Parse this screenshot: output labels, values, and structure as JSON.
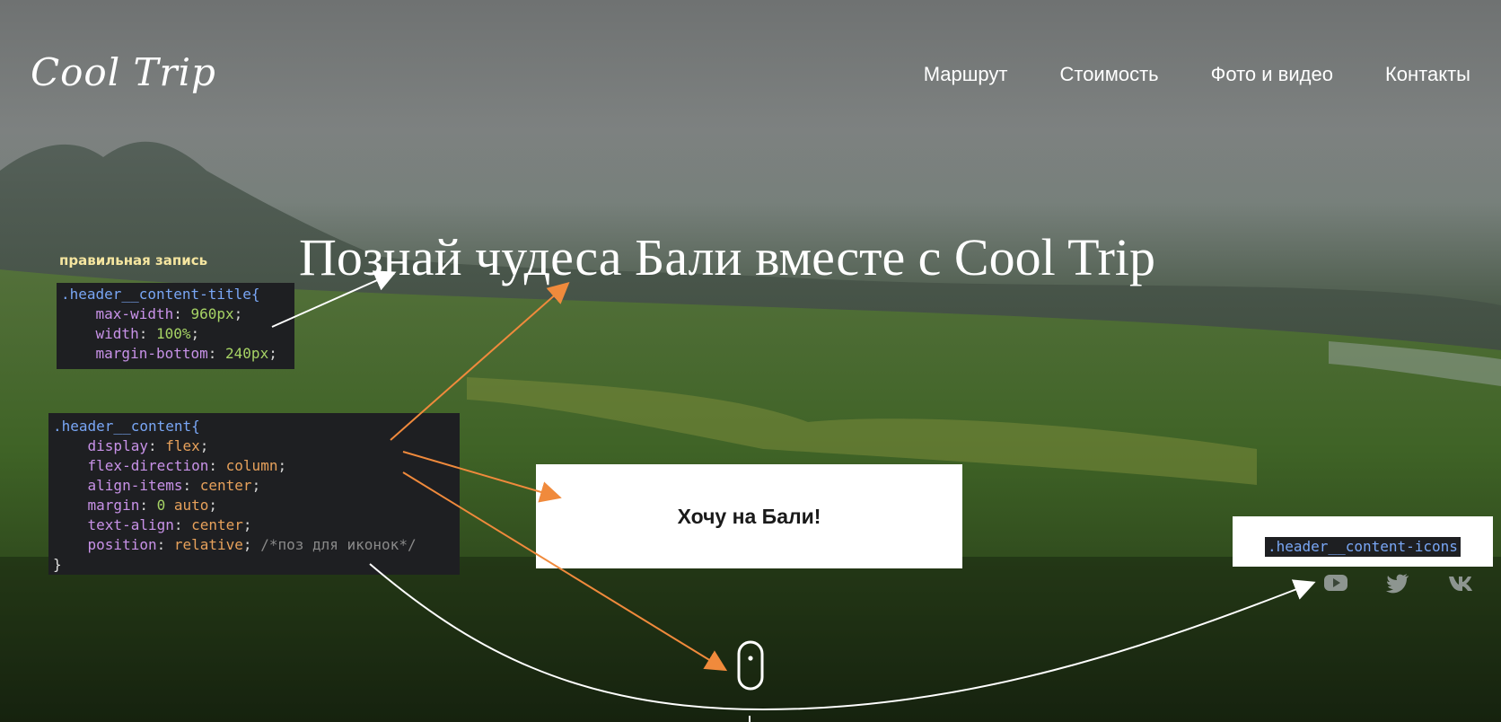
{
  "header": {
    "logo": "Cool Trip",
    "nav": [
      {
        "label": "Маршрут"
      },
      {
        "label": "Стоимость"
      },
      {
        "label": "Фото и видео"
      },
      {
        "label": "Контакты"
      }
    ]
  },
  "hero": {
    "title": "Познай чудеса Бали вместе с Cool Trip",
    "cta_label": "Хочу на Бали!"
  },
  "annotations": {
    "note_label": "правильная запись",
    "code_title_block": {
      "selector": ".header__content-title{",
      "lines": [
        {
          "prop": "max-width",
          "value": "960px"
        },
        {
          "prop": "width",
          "value": "100%"
        },
        {
          "prop": "margin-bottom",
          "value": "240px"
        }
      ]
    },
    "code_content_block": {
      "selector": ".header__content{",
      "lines": [
        {
          "prop": "display",
          "value": "flex"
        },
        {
          "prop": "flex-direction",
          "value": "column"
        },
        {
          "prop": "align-items",
          "value": "center"
        },
        {
          "prop": "margin",
          "value_num": "0",
          "value": "auto"
        },
        {
          "prop": "text-align",
          "value": "center"
        },
        {
          "prop": "position",
          "value": "relative",
          "comment": "/*поз для иконок*/"
        }
      ],
      "close": "}"
    },
    "icons_selector": ".header__content-icons"
  },
  "social_icons": [
    "youtube-icon",
    "twitter-icon",
    "vk-icon"
  ],
  "colors": {
    "arrow_orange": "#f08a3c",
    "arrow_white": "#ffffff",
    "code_bg": "#1e1f22",
    "selector": "#79a6f5",
    "property": "#c892e8",
    "number": "#a7d465",
    "keyword": "#e7a15b"
  }
}
